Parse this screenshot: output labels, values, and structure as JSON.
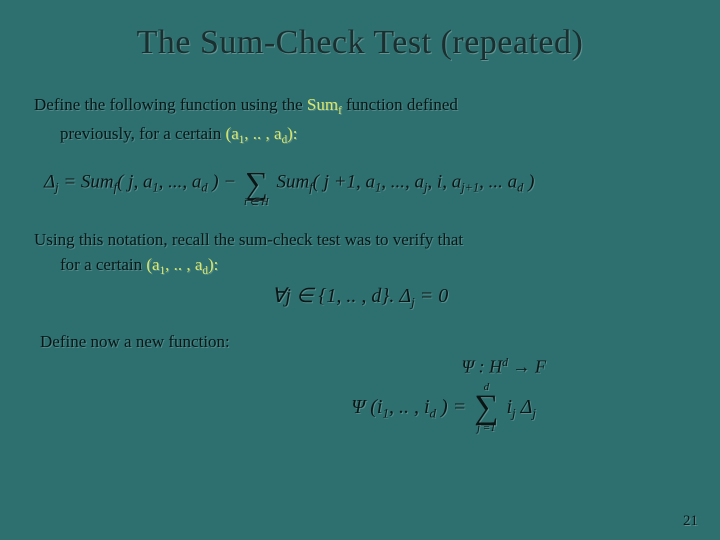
{
  "title": "The Sum-Check Test (repeated)",
  "p1_a": "Define the following function using the ",
  "p1_sum": "Sum",
  "p1_f": "f",
  "p1_b": " function defined",
  "p1_c": "previously, for a certain ",
  "p1_tuple_open": "(a",
  "p1_tuple_mid": ", .. , a",
  "p1_tuple_close": "):",
  "p2_a": "Using this notation, recall the sum-check test was to verify that",
  "p2_b": "for a certain ",
  "p3": "Define now a new function:",
  "eq1": {
    "delta": "Δ",
    "j": "j",
    "eq": " = ",
    "Sum": "Sum",
    "f": "f",
    "args1": "( j, a",
    "one": "1",
    "mid": ", ..., a",
    "d": "d",
    "close": " ) − ",
    "args2": "( j +1, a",
    "mid2": ", ..., a",
    "jidx": "j",
    "comma_i": ", i, a",
    "jp1": "j+1",
    "tail": ", ... a",
    "sum_lim": "i ∈ H"
  },
  "eq2": {
    "forall": "∀",
    "j": "j",
    "in": " ∈ {1, .. , ",
    "d": "d",
    "close": "}.  Δ",
    "eq0": " = 0"
  },
  "eq3": {
    "psi": "Ψ : H",
    "d": "d",
    "to": " → F"
  },
  "eq4": {
    "psi": "Ψ (i",
    "one": "1",
    "mid": ", .. , i",
    "d": "d",
    "close": " ) = ",
    "sum_top": "d",
    "sum_bot": "j =1",
    "ij": "i",
    "jj": "j",
    "delta": " Δ"
  },
  "pageno": "21"
}
